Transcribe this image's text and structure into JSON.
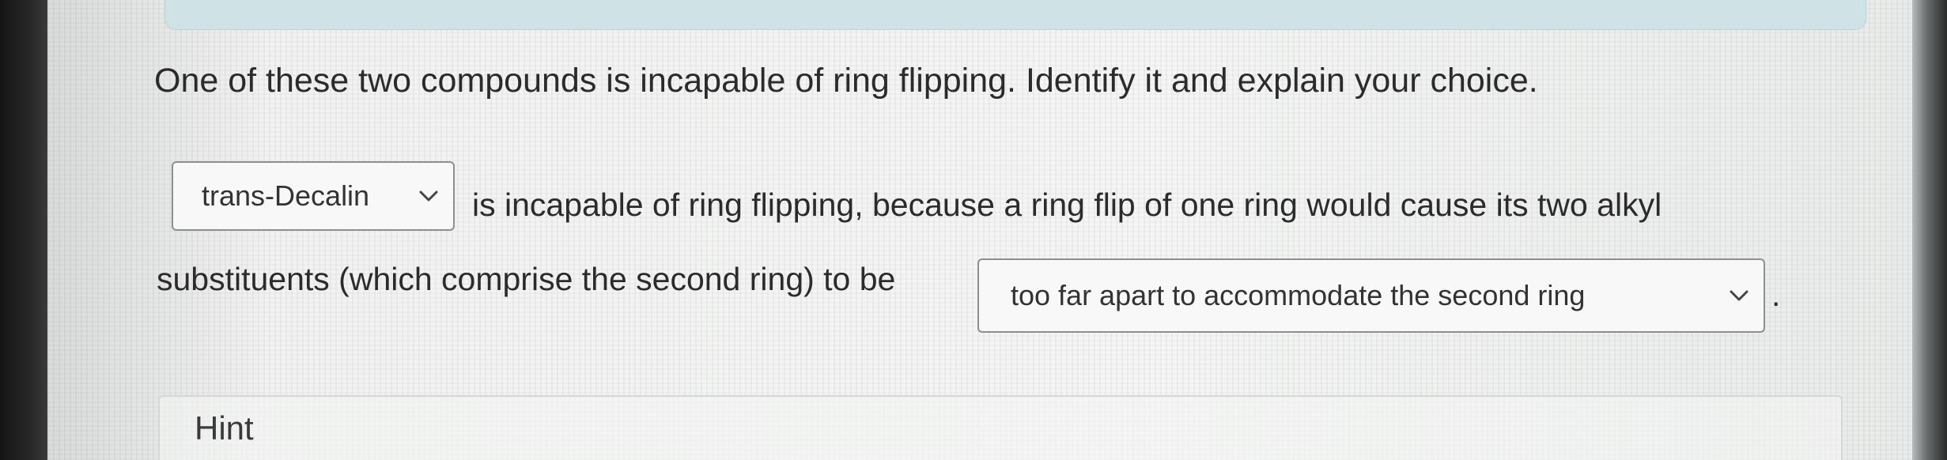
{
  "question": {
    "prompt": "One of these two compounds is incapable of ring flipping. Identify it and explain your choice."
  },
  "answer": {
    "compound_select": {
      "value": "trans-Decalin"
    },
    "text_after_compound": "is incapable of ring flipping, because a ring flip of one ring would cause its two alkyl",
    "text_before_reason": "substituents (which comprise the second ring) to be",
    "reason_select": {
      "value": "too far apart to accommodate the second ring"
    },
    "end_punctuation": "."
  },
  "hint": {
    "label": "Hint"
  },
  "colors": {
    "page_background": "#eef0ef",
    "text": "#2b2b2b",
    "select_border": "#8c8f90",
    "top_strip": "#cfe3e6"
  },
  "icons": {
    "dropdown": "chevron-down-icon"
  }
}
